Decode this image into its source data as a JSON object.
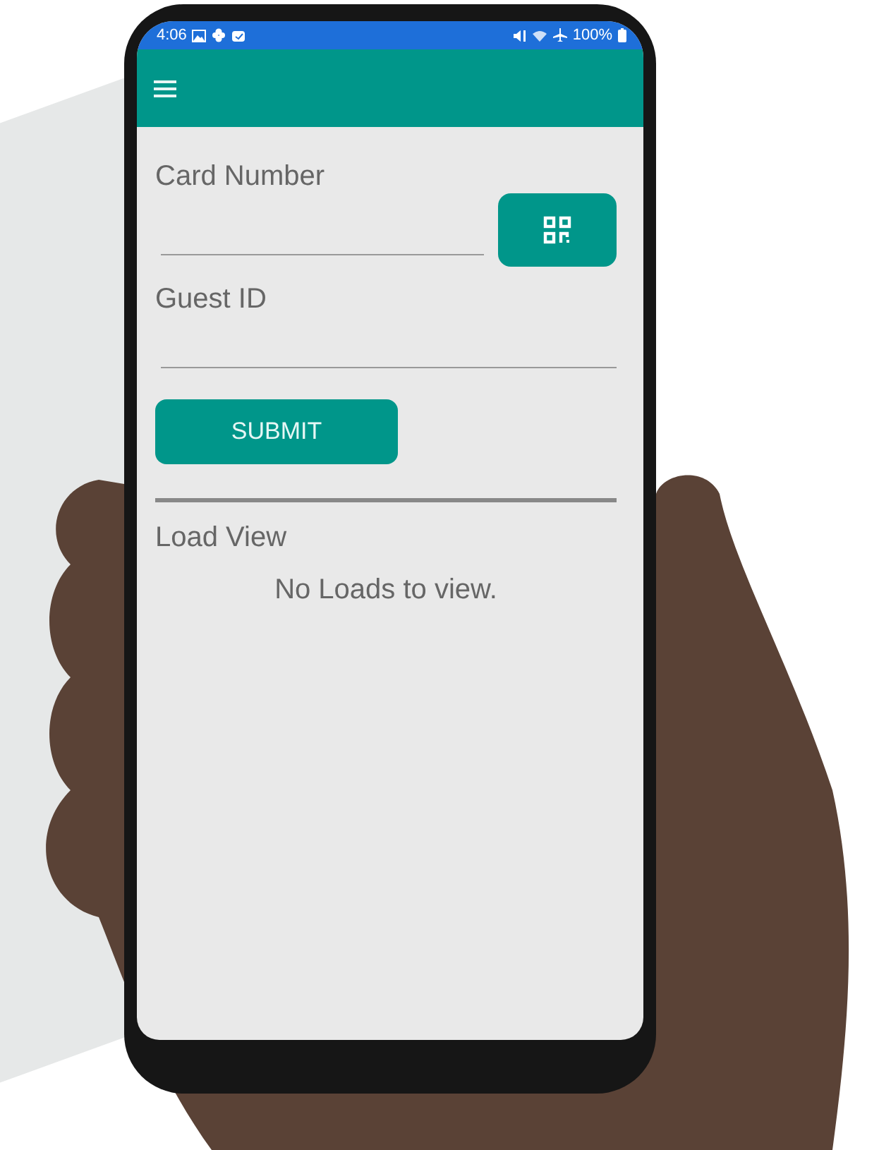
{
  "status_bar": {
    "time": "4:06",
    "battery": "100%"
  },
  "form": {
    "fields": [
      {
        "label": "Card Number",
        "scan_button": true
      },
      {
        "label": "Guest ID",
        "scan_button": false
      }
    ],
    "submit": "SUBMIT"
  },
  "load_view": {
    "title": "Load View",
    "empty_message": "No Loads to view."
  }
}
